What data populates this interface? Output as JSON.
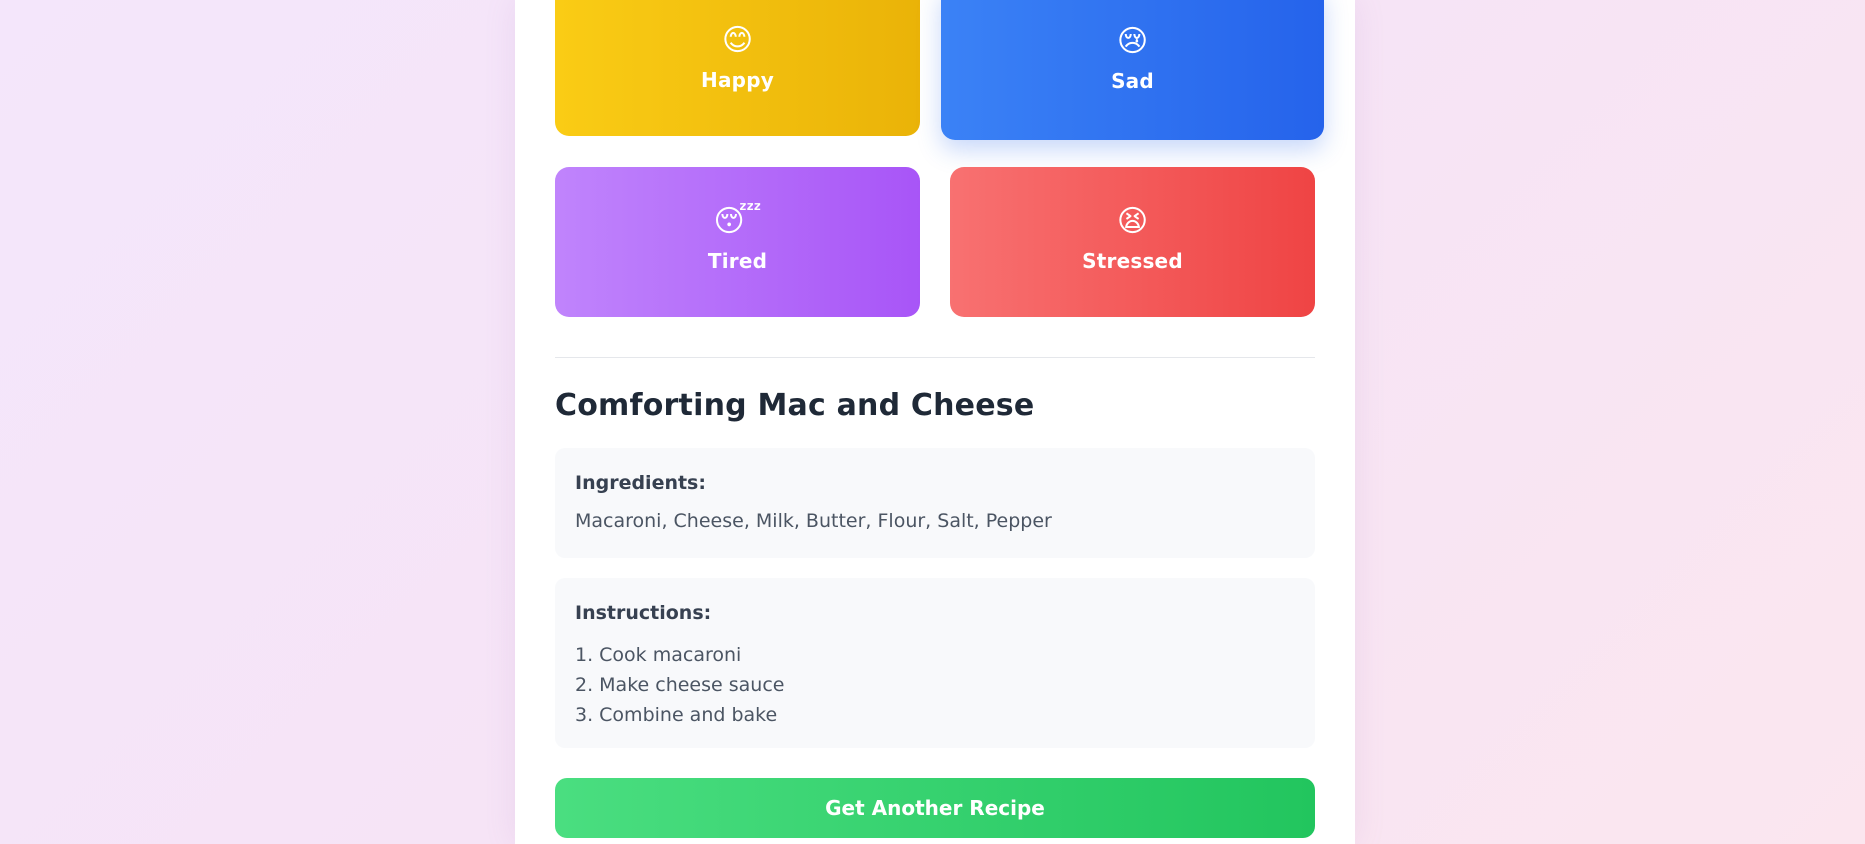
{
  "moods": [
    {
      "id": "happy",
      "emoji": "😊",
      "label": "Happy",
      "color": "#eab308"
    },
    {
      "id": "sad",
      "emoji": "😢",
      "label": "Sad",
      "color": "#2563eb"
    },
    {
      "id": "tired",
      "emoji": "😴",
      "label": "Tired",
      "color": "#a855f7"
    },
    {
      "id": "stressed",
      "emoji": "😫",
      "label": "Stressed",
      "color": "#ef4444"
    }
  ],
  "recipe": {
    "title": "Comforting Mac and Cheese",
    "ingredients_heading": "Ingredients:",
    "ingredients": "Macaroni, Cheese, Milk, Butter, Flour, Salt, Pepper",
    "instructions_heading": "Instructions:",
    "steps": [
      "1. Cook macaroni",
      "2. Make cheese sauce",
      "3. Combine and bake"
    ]
  },
  "actions": {
    "another_recipe_label": "Get Another Recipe",
    "button_color": "#22c55e"
  }
}
